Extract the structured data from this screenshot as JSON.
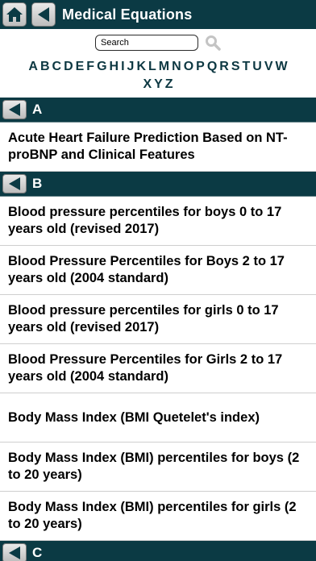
{
  "header": {
    "title": "Medical Equations",
    "home_icon": "home-icon",
    "back_icon": "back-arrow-icon"
  },
  "search": {
    "placeholder": "Search",
    "icon": "magnifier-icon"
  },
  "alphabet": [
    "A",
    "B",
    "C",
    "D",
    "E",
    "F",
    "G",
    "H",
    "I",
    "J",
    "K",
    "L",
    "M",
    "N",
    "O",
    "P",
    "Q",
    "R",
    "S",
    "T",
    "U",
    "V",
    "W",
    "X",
    "Y",
    "Z"
  ],
  "sections": [
    {
      "letter": "A",
      "items": [
        "Acute Heart Failure Prediction Based on NT-proBNP and Clinical Features"
      ]
    },
    {
      "letter": "B",
      "items": [
        "Blood pressure percentiles for boys 0 to 17 years old (revised 2017)",
        "Blood Pressure Percentiles for Boys 2 to 17 years old (2004 standard)",
        "Blood pressure percentiles for girls 0 to 17 years old (revised 2017)",
        "Blood Pressure Percentiles for Girls 2 to 17 years old (2004 standard)",
        "Body Mass Index (BMI Quetelet's index)",
        "Body Mass Index (BMI) percentiles for boys (2 to 20 years)",
        "Body Mass Index (BMI) percentiles for girls (2 to 20 years)"
      ]
    },
    {
      "letter": "C",
      "items": []
    }
  ],
  "colors": {
    "header_bg": "#0b3a44",
    "alphabet_text": "#0d3842"
  }
}
